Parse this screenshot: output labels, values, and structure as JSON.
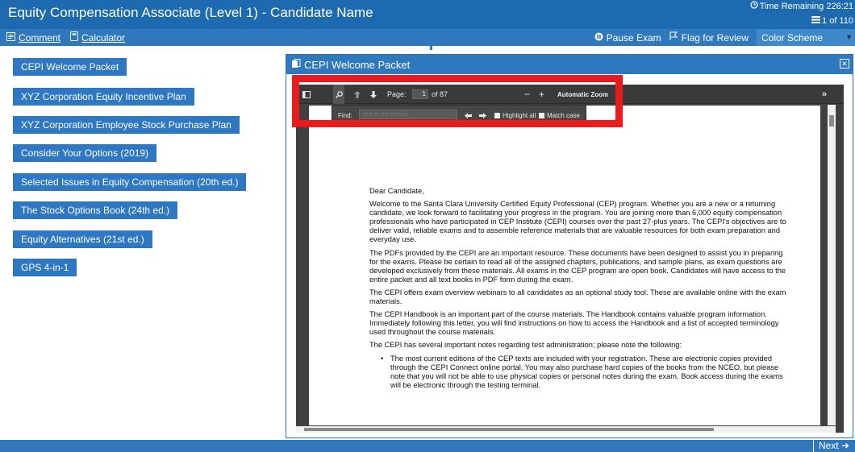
{
  "header": {
    "title": "Equity Compensation Associate (Level 1) - Candidate Name",
    "time_remaining": "Time Remaining 226:21",
    "question_counter": "1 of 110"
  },
  "toolbar": {
    "comment_label": "Comment",
    "calculator_label": "Calculator",
    "pause_label": "Pause Exam",
    "flag_label": "Flag for Review",
    "color_scheme_label": "Color Scheme"
  },
  "sidebar": {
    "items": [
      {
        "label": "CEPI Welcome Packet"
      },
      {
        "label": "XYZ Corporation Equity Incentive Plan"
      },
      {
        "label": "XYZ Corporation Employee Stock Purchase Plan"
      },
      {
        "label": "Consider Your Options (2019)"
      },
      {
        "label": "Selected Issues in Equity Compensation (20th ed.)"
      },
      {
        "label": "The Stock Options Book (24th ed.)"
      },
      {
        "label": "Equity Alternatives (21st ed.)"
      },
      {
        "label": "GPS 4-in-1"
      }
    ]
  },
  "viewer": {
    "title": "CEPI Welcome Packet",
    "pdf_toolbar": {
      "page_label": "Page:",
      "page_value": "1",
      "page_total": "of 87",
      "zoom_label": "Automatic Zoom"
    },
    "find_bar": {
      "label": "Find:",
      "placeholder": "Text to find phrase",
      "highlight_all_label": "Highlight all",
      "match_case_label": "Match case"
    },
    "document": {
      "salutation": "Dear Candidate,",
      "paragraphs": [
        "Welcome to the Santa Clara University Certified Equity Professional (CEP) program. Whether you are a new or a returning candidate, we look forward to facilitating your progress in the program. You are joining more than 6,000 equity compensation professionals who have participated in CEP Institute (CEPI) courses over the past 27-plus years. The CEPI's objectives are to deliver valid, reliable exams and to assemble reference materials that are valuable resources for both exam preparation and everyday use.",
        "The PDFs provided by the CEPI are an important resource. These documents have been designed to assist you in preparing for the exams. Please be certain to read all of the assigned chapters, publications, and sample plans, as exam questions are developed exclusively from these materials. All exams in the CEP program are open book. Candidates will have access to the entire packet and all text books in PDF form during the exam.",
        "The CEPI offers exam overview webinars to all candidates as an optional study tool. These are available online with the exam materials.",
        "The CEPI Handbook is an important part of the course materials. The Handbook contains valuable program information. Immediately following this letter, you will find instructions on how to access the Handbook and a list of accepted terminology used throughout the course materials.",
        "The CEPI has several important notes regarding test administration; please note the following:"
      ],
      "bullets": [
        "The most current editions of the CEP texts are included with your registration. These are electronic copies provided through the CEPI Connect online portal. You may also purchase hard copies of the books from the NCEO, but please note that you will not be able to use physical copies or personal notes during the exam. Book access during the exams will be electronic through the testing terminal."
      ]
    }
  },
  "footer": {
    "next_label": "Next"
  },
  "icons": {
    "clock": "clock-icon",
    "questions": "list-icon",
    "comment": "comment-icon",
    "calculator": "calculator-icon",
    "pause": "pause-icon",
    "flag": "flag-icon"
  },
  "colors": {
    "header_blue": "#1d6ab0",
    "toolbar_blue": "#2f78bd",
    "button_blue": "#2e77c3",
    "highlight_red": "#e81c1c"
  }
}
